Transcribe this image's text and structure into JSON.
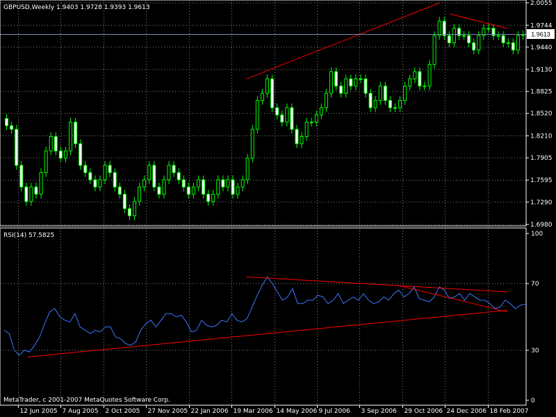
{
  "window": {
    "symbol_header": "GBPUSD,Weekly  1.9403 1.9728 1.9393 1.9613",
    "rsi_header": "RSI(14) 57.5825",
    "copyright": "MetaTrader, c 2001-2007 MetaQuotes Software Corp.",
    "current_price": "1.9613"
  },
  "colors": {
    "background": "#000000",
    "grid": "#8a8a8a",
    "axis": "#ffffff",
    "candle": "#00ff00",
    "rsi_line": "#3d78ff",
    "trendline": "#ff0000",
    "price_line": "#7f8fb0"
  },
  "chart_data": [
    {
      "type": "candlestick",
      "title": "GBPUSD,Weekly",
      "y_ticks": [
        "2.0055",
        "1.9744",
        "1.9440",
        "1.9130",
        "1.8825",
        "1.8520",
        "1.8210",
        "1.7905",
        "1.7595",
        "1.7290",
        "1.6980"
      ],
      "ylim": [
        1.698,
        2.0055
      ],
      "x_tick_labels": [
        "12 Jun 2005",
        "7 Aug 2005",
        "2 Oct 2005",
        "27 Nov 2005",
        "22 Jan 2006",
        "19 Mar 2006",
        "14 May 2006",
        "9 Jul 2006",
        "3 Sep 2006",
        "29 Oct 2006",
        "24 Dec 2006",
        "18 Feb 2007"
      ],
      "current_price": 1.9613,
      "closes": [
        1.835,
        1.83,
        1.78,
        1.75,
        1.73,
        1.75,
        1.74,
        1.77,
        1.8,
        1.82,
        1.8,
        1.79,
        1.8,
        1.84,
        1.81,
        1.78,
        1.77,
        1.76,
        1.75,
        1.76,
        1.78,
        1.77,
        1.75,
        1.74,
        1.72,
        1.71,
        1.73,
        1.75,
        1.76,
        1.78,
        1.75,
        1.74,
        1.76,
        1.78,
        1.77,
        1.76,
        1.75,
        1.74,
        1.75,
        1.76,
        1.74,
        1.73,
        1.74,
        1.76,
        1.75,
        1.76,
        1.74,
        1.75,
        1.76,
        1.79,
        1.83,
        1.87,
        1.88,
        1.9,
        1.86,
        1.85,
        1.84,
        1.86,
        1.83,
        1.81,
        1.82,
        1.84,
        1.84,
        1.85,
        1.86,
        1.88,
        1.91,
        1.89,
        1.88,
        1.9,
        1.89,
        1.9,
        1.9,
        1.88,
        1.86,
        1.87,
        1.89,
        1.87,
        1.86,
        1.86,
        1.87,
        1.89,
        1.9,
        1.91,
        1.89,
        1.89,
        1.92,
        1.96,
        1.98,
        1.96,
        1.95,
        1.97,
        1.96,
        1.96,
        1.95,
        1.94,
        1.96,
        1.97,
        1.97,
        1.96,
        1.96,
        1.95,
        1.95,
        1.94,
        1.96,
        1.9613
      ],
      "trendlines": [
        {
          "x": [
            "19 Mar 2006 + 3w",
            "24 Dec 2006 - 1w"
          ],
          "y": [
            1.9,
            2.0055
          ]
        },
        {
          "x": [
            "24 Dec 2006 + 1w",
            "18 Feb 2007 + 4w"
          ],
          "y": [
            1.99,
            1.97
          ]
        }
      ]
    },
    {
      "type": "line",
      "title": "RSI(14) 57.5825",
      "series": [
        {
          "name": "RSI(14)",
          "values": [
            42,
            40,
            30,
            27,
            30,
            29,
            33,
            38,
            46,
            53,
            55,
            50,
            48,
            47,
            52,
            44,
            42,
            40,
            42,
            41,
            44,
            44,
            38,
            37,
            34,
            33,
            35,
            42,
            46,
            48,
            44,
            48,
            52,
            52,
            50,
            51,
            47,
            41,
            42,
            48,
            45,
            44,
            45,
            48,
            47,
            52,
            48,
            47,
            49,
            56,
            63,
            69,
            74,
            70,
            65,
            60,
            62,
            67,
            58,
            58,
            60,
            60,
            63,
            62,
            58,
            60,
            64,
            58,
            60,
            62,
            60,
            64,
            60,
            58,
            59,
            62,
            60,
            64,
            66,
            62,
            64,
            68,
            61,
            60,
            59,
            62,
            68,
            66,
            61,
            62,
            64,
            60,
            64,
            62,
            60,
            60,
            58,
            55,
            56,
            60,
            58,
            55,
            57,
            57.58
          ]
        }
      ],
      "ylim": [
        0,
        100
      ],
      "y_ticks": [
        "100",
        "70",
        "30",
        "0"
      ],
      "trendlines": [
        {
          "x": [
            "12 Jun 2005 + 2w",
            "18 Feb 2007 + 4w"
          ],
          "y": [
            26,
            54
          ]
        },
        {
          "x": [
            "19 Mar 2006 + 3w",
            "18 Feb 2007 + 4w"
          ],
          "y": [
            74,
            65
          ]
        },
        {
          "x": [
            "29 Oct 2006 - 1w",
            "18 Feb 2007 + 4w"
          ],
          "y": [
            69,
            53
          ]
        }
      ]
    }
  ]
}
